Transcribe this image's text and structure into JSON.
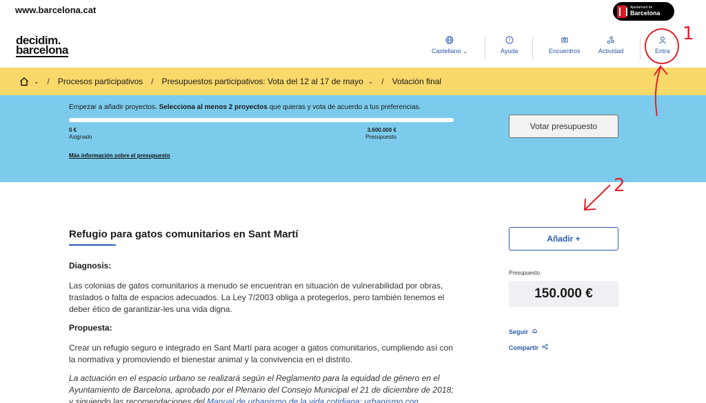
{
  "topbar": {
    "site_link": "www.barcelona.cat",
    "ajuntament_small": "Ajuntament de",
    "ajuntament_big": "Barcelona"
  },
  "header": {
    "logo_line1": "decidim.",
    "logo_line2": "barcelona",
    "nav": [
      {
        "label": "Castellano",
        "icon": "globe-icon"
      },
      {
        "label": "Ayuda",
        "icon": "help-icon"
      },
      {
        "label": "Encuentros",
        "icon": "meetings-icon"
      },
      {
        "label": "Actividad",
        "icon": "activity-icon"
      },
      {
        "label": "Entra",
        "icon": "user-icon"
      }
    ]
  },
  "breadcrumb": {
    "items": [
      "Procesos participativos",
      "Presupuestos participativos: Vota del 12 al 17 de mayo",
      "Votación final"
    ]
  },
  "budget": {
    "intro_pre": "Empezar a añadir proyectos. ",
    "intro_bold": "Selecciona al menos 2 proyectos",
    "intro_post": " que quieras y vota de acuerdo a tus preferencias.",
    "progress_fraction": 0,
    "assigned_value": "0 €",
    "assigned_label": "Asignado",
    "total_value": "3.600.000 €",
    "total_label": "Presupuesto",
    "more_info": "Más información sobre el presupuesto",
    "vote_button": "Votar presupuesto"
  },
  "project": {
    "title": "Refugio para gatos comunitarios en Sant Martí",
    "diagnosis_heading": "Diagnosis:",
    "diagnosis_text": "Las colonias de gatos comunitarios a menudo se encuentran en situación de vulnerabilidad por obras, traslados o falta de espacios adecuados. La Ley 7/2003 obliga a protegerlos, pero también tenemos el deber ético de garantizar-les una vida digna.",
    "proposal_heading": "Propuesta:",
    "proposal_text": "Crear un refugio seguro e integrado en Sant Martí para acoger a gatos comunitarios, cumpliendo así con la normativa y promoviendo el bienestar animal y la convivencia en el distrito.",
    "note_text": "La actuación en el espacio urbano se realizará según el Reglamento para la equidad de género en el Ayuntamiento de Barcelona, aprobado por el Plenario del Consejo Municipal el 21 de diciembre de 2018; y siguiendo las recomendaciones del ",
    "note_link": "Manual de urbanismo de la vida cotidiana: urbanismo con perspectiva de"
  },
  "sidebar": {
    "add_button": "Añadir +",
    "budget_label": "Presupuesto",
    "budget_value": "150.000 €",
    "follow": "Seguir",
    "share": "Compartir"
  },
  "annotations": {
    "label_1": "1",
    "label_2": "2",
    "color": "#e0202a"
  },
  "colors": {
    "accent": "#2b5aa8",
    "breadcrumb_bg": "#fad96b",
    "budget_bg": "#7ccbec"
  }
}
